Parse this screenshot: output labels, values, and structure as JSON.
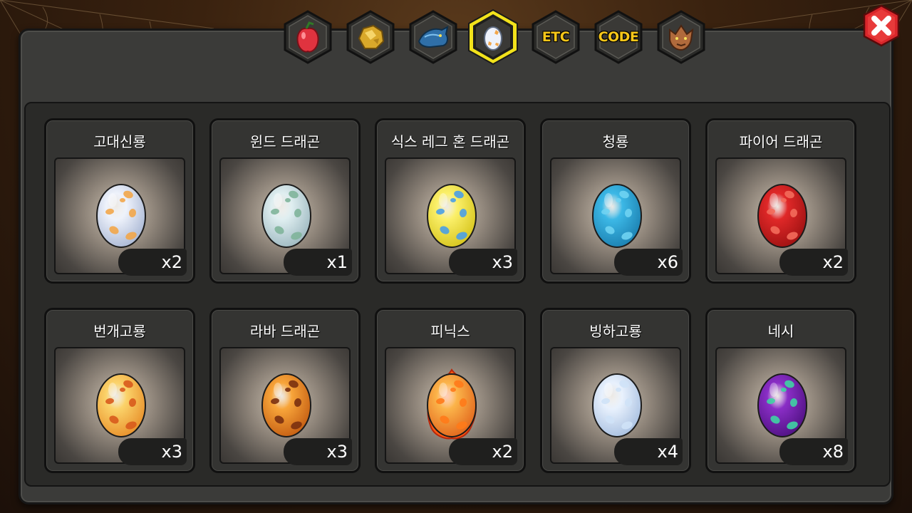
{
  "tabs": [
    {
      "id": "fruit",
      "label": "",
      "icon": "fruit-icon",
      "selected": false
    },
    {
      "id": "gold",
      "label": "",
      "icon": "gold-nugget-icon",
      "selected": false
    },
    {
      "id": "dragon-scale",
      "label": "",
      "icon": "dragon-head-icon",
      "selected": false
    },
    {
      "id": "egg",
      "label": "",
      "icon": "egg-icon",
      "selected": true
    },
    {
      "id": "etc",
      "label": "ETC",
      "icon": "",
      "selected": false
    },
    {
      "id": "code",
      "label": "CODE",
      "icon": "",
      "selected": false
    },
    {
      "id": "beast",
      "label": "",
      "icon": "beast-head-icon",
      "selected": false
    }
  ],
  "close_icon": "close-icon",
  "colors": {
    "accent": "#f6c619",
    "close_red": "#d9262b",
    "panel": "#3b3b39"
  },
  "eggs": [
    {
      "name": "고대신룡",
      "count": "x2",
      "base": "#eef2fb",
      "shade": "#a9b7d4",
      "spots": "#f2a64a"
    },
    {
      "name": "윈드 드래곤",
      "count": "x1",
      "base": "#dfeef0",
      "shade": "#9db8c0",
      "spots": "#7fb49a"
    },
    {
      "name": "식스 레그 혼 드래곤",
      "count": "x3",
      "base": "#fbf06a",
      "shade": "#d6c41c",
      "spots": "#4a9fe6"
    },
    {
      "name": "청룡",
      "count": "x6",
      "base": "#3cb8e6",
      "shade": "#1b7fb0",
      "spots": "#6fd3f2"
    },
    {
      "name": "파이어 드래곤",
      "count": "x2",
      "base": "#e02828",
      "shade": "#9e1212",
      "spots": "#f36b5b"
    },
    {
      "name": "번개고룡",
      "count": "x3",
      "base": "#fbd36a",
      "shade": "#e88f2a",
      "spots": "#d85a1c"
    },
    {
      "name": "라바 드래곤",
      "count": "x3",
      "base": "#f8a53a",
      "shade": "#c45d12",
      "spots": "#7a3010"
    },
    {
      "name": "피닉스",
      "count": "x2",
      "base": "#fbb44a",
      "shade": "#e2661c",
      "spots": "#ff7a1a"
    },
    {
      "name": "빙하고룡",
      "count": "x4",
      "base": "#e8f1fd",
      "shade": "#a7bfe0",
      "spots": "#cfe2f7"
    },
    {
      "name": "네시",
      "count": "x8",
      "base": "#8a2ec6",
      "shade": "#4f1182",
      "spots": "#3fd3a3"
    }
  ]
}
